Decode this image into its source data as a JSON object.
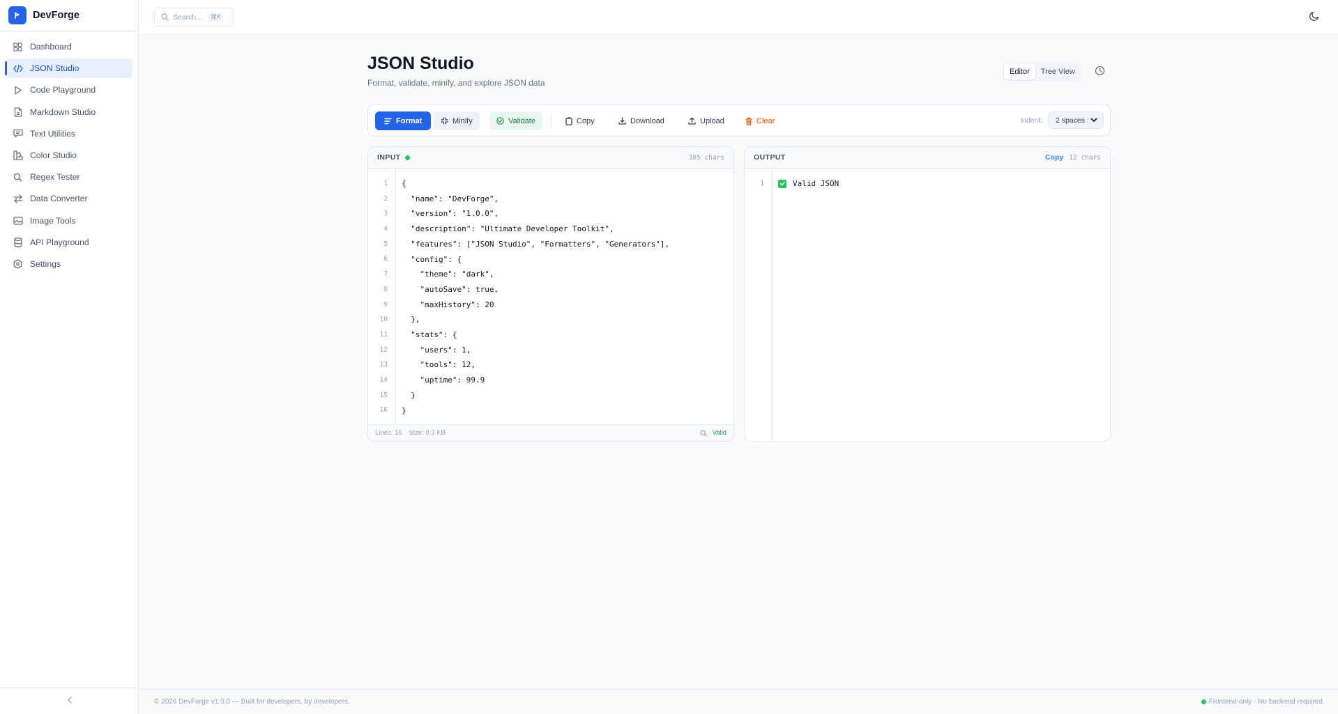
{
  "app": {
    "name": "DevForge"
  },
  "sidebar": {
    "items": [
      {
        "label": "Dashboard",
        "icon": "grid-icon"
      },
      {
        "label": "JSON Studio",
        "icon": "code-icon",
        "active": true
      },
      {
        "label": "Code Playground",
        "icon": "play-icon"
      },
      {
        "label": "Markdown Studio",
        "icon": "file-icon"
      },
      {
        "label": "Text Utilities",
        "icon": "message-icon"
      },
      {
        "label": "Color Studio",
        "icon": "palette-icon"
      },
      {
        "label": "Regex Tester",
        "icon": "search-icon"
      },
      {
        "label": "Data Converter",
        "icon": "swap-icon"
      },
      {
        "label": "Image Tools",
        "icon": "image-icon"
      },
      {
        "label": "API Playground",
        "icon": "database-icon"
      },
      {
        "label": "Settings",
        "icon": "gear-icon"
      }
    ]
  },
  "topbar": {
    "search_placeholder": "Search...",
    "search_shortcut": "⌘K"
  },
  "page": {
    "title": "JSON Studio",
    "subtitle": "Format, validate, minify, and explore JSON data",
    "view_tabs": [
      "Editor",
      "Tree View"
    ],
    "active_view": "Editor"
  },
  "toolbar": {
    "format": "Format",
    "minify": "Minify",
    "validate": "Validate",
    "copy": "Copy",
    "download": "Download",
    "upload": "Upload",
    "clear": "Clear",
    "indent_label": "Indent:",
    "indent_value": "2 spaces"
  },
  "input_panel": {
    "label": "INPUT",
    "char_count": "385 chars",
    "lines": [
      "{",
      "  \"name\": \"DevForge\",",
      "  \"version\": \"1.0.0\",",
      "  \"description\": \"Ultimate Developer Toolkit\",",
      "  \"features\": [\"JSON Studio\", \"Formatters\", \"Generators\"],",
      "  \"config\": {",
      "    \"theme\": \"dark\",",
      "    \"autoSave\": true,",
      "    \"maxHistory\": 20",
      "  },",
      "  \"stats\": {",
      "    \"users\": 1,",
      "    \"tools\": 12,",
      "    \"uptime\": 99.9",
      "  }",
      "}"
    ],
    "footer_lines": "Lines: 16",
    "footer_size": "Size: 0.3 KB",
    "footer_status": "Valid"
  },
  "output_panel": {
    "label": "OUTPUT",
    "copy_label": "Copy",
    "char_count": "12 chars",
    "line_number": "1",
    "result": "Valid JSON"
  },
  "footer": {
    "left": "© 2026 DevForge v1.0.0 — Built for developers, by developers.",
    "right": "Frontend-only · No backend required"
  },
  "colors": {
    "accent": "#2563eb",
    "success": "#22c55e",
    "danger": "#ea580c"
  }
}
